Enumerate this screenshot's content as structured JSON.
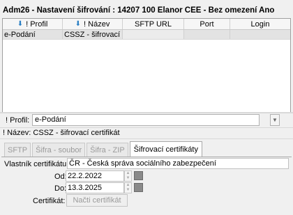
{
  "title": "Adm26 - Nastavení šifrování : 14207   100   Elanor CEE   - Bez omezení   Ano",
  "grid": {
    "columns": [
      {
        "label": "! Profil",
        "sorted": true
      },
      {
        "label": "! Název",
        "sorted": true
      },
      {
        "label": "SFTP URL",
        "sorted": false
      },
      {
        "label": "Port",
        "sorted": false
      },
      {
        "label": "Login",
        "sorted": false
      }
    ],
    "rows": [
      {
        "profil": "e-Podání",
        "nazev": "CSSZ - šifrovací",
        "sftp": "",
        "port": "",
        "login": ""
      }
    ]
  },
  "form": {
    "profil_label": "! Profil:",
    "profil_value": "e-Podání",
    "nazev_label": "! Název:",
    "nazev_value": "CSSZ - šifrovací certifikát"
  },
  "tabs": [
    {
      "label": "SFTP",
      "active": false
    },
    {
      "label": "Šifra - soubor",
      "active": false
    },
    {
      "label": "Šifra - ZIP",
      "active": false
    },
    {
      "label": "Šifrovací certifikáty",
      "active": true
    }
  ],
  "certificate": {
    "owner_label": "Vlastník certifikátu:",
    "owner_value": "ČR - Česká správa sociálního zabezpečení",
    "from_label": "Od:",
    "from_value": "22.2.2022",
    "to_label": "Do:",
    "to_value": "13.3.2025",
    "cert_label": "Certifikát:",
    "load_button": "Načti certifikát"
  },
  "icons": {
    "sort": "sort-down-arrow-icon",
    "dropdown": "chevron-down-icon",
    "calendar": "calendar-icon"
  },
  "colors": {
    "sort_arrow": "#2a7fc4",
    "selected_row": "#e3e3e3",
    "disabled_text": "#9a9a9a"
  }
}
